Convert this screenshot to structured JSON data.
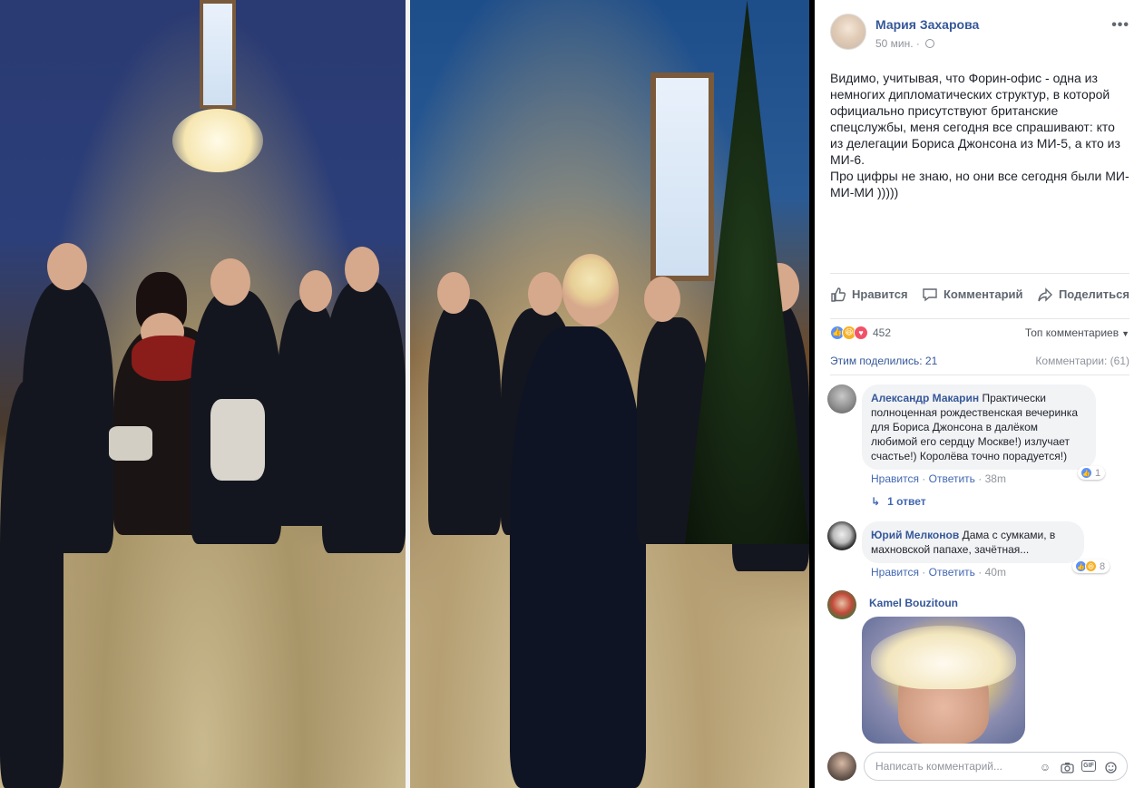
{
  "post": {
    "author": "Мария Захарова",
    "time": "50 мин. ·",
    "text": [
      "Видимо, учитывая, что Форин-офис - одна из немногих дипломатических структур, в которой официально присутствуют британские спецслужбы, меня сегодня все спрашивают: кто из делегации Бориса Джонсона из МИ-5, а кто из МИ-6.",
      "Про цифры не знаю, но они все сегодня были МИ-МИ-МИ )))))"
    ]
  },
  "actions": {
    "like": "Нравится",
    "comment": "Комментарий",
    "share": "Поделиться"
  },
  "stats": {
    "reactions_count": "452",
    "top_comments": "Топ комментариев",
    "shared": "Этим поделились: 21",
    "comments_count": "Комментарии: (61)"
  },
  "comments": [
    {
      "name": "Александр Макарин",
      "text_lines": [
        "Практически",
        "полноценная рождественская вечеринка",
        "для Бориса Джонсона в далёком",
        "любимой его сердцу Москве!) излучает",
        "счастье!) Королёва точно порадуется!)"
      ],
      "like": "Нравится",
      "reply": "Ответить",
      "time": "38m",
      "reactions": "1",
      "replies": "1 ответ"
    },
    {
      "name": "Юрий Мелконов",
      "text_lines": [
        "Дама с сумками, в",
        "махновской папахе, зачётная..."
      ],
      "like": "Нравится",
      "reply": "Ответить",
      "time": "40m",
      "reactions": "8"
    },
    {
      "name": "Kamel Bouzitoun"
    }
  ],
  "composer": {
    "placeholder": "Написать комментарий..."
  },
  "colors": {
    "link": "#365899",
    "action_blue": "#4267b2",
    "muted": "#90949c"
  },
  "icons": [
    "more-icon",
    "globe-icon",
    "like-icon",
    "comment-icon",
    "share-icon",
    "emoji-icon",
    "camera-icon",
    "gif-icon",
    "sticker-icon"
  ]
}
